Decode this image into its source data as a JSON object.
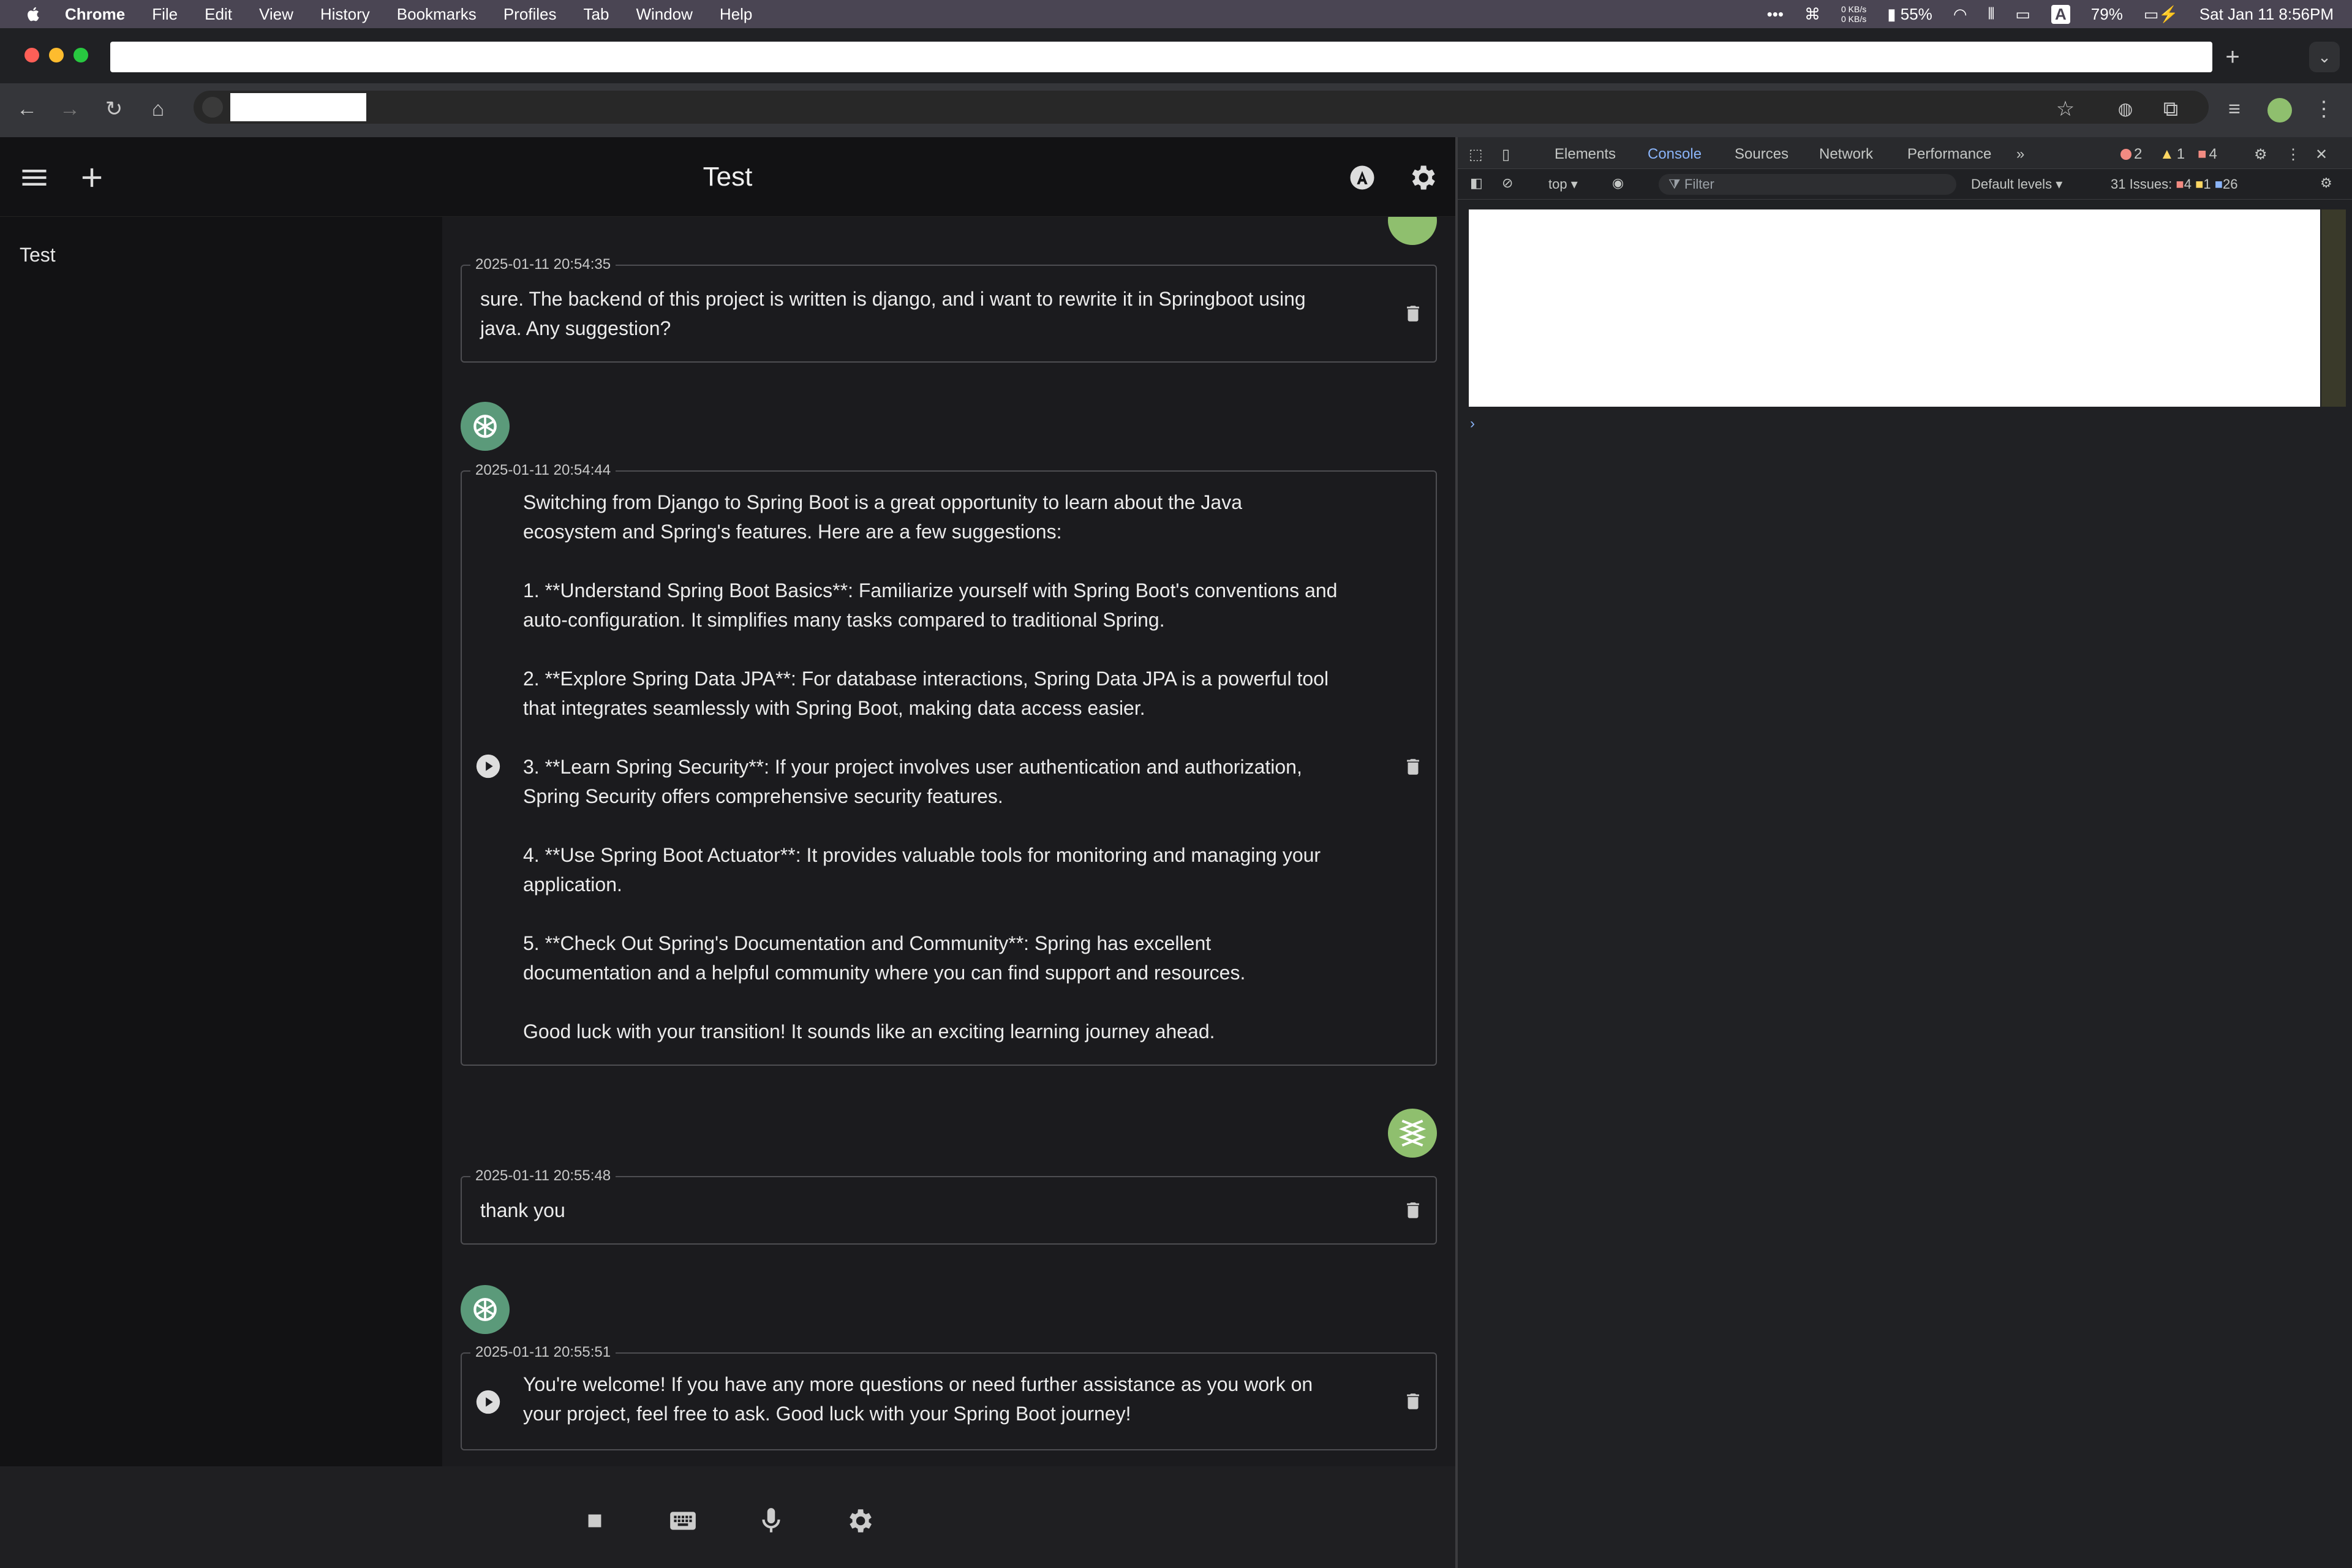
{
  "menubar": {
    "app_name": "Chrome",
    "menus": [
      "File",
      "Edit",
      "View",
      "History",
      "Bookmarks",
      "Profiles",
      "Tab",
      "Window",
      "Help"
    ],
    "net_up": "0 KB/s",
    "net_down": "0 KB/s",
    "cpu_percent": "55%",
    "input_source": "A",
    "battery_percent": "79%",
    "datetime": "Sat Jan 11  8:56PM"
  },
  "app": {
    "title": "Test",
    "sidebar": {
      "items": [
        {
          "label": "Test"
        }
      ]
    },
    "messages": [
      {
        "role": "user",
        "timestamp": "2025-01-11 20:54:35",
        "text": "sure. The backend of this project is written is django, and i want to rewrite it in Springboot using\njava. Any suggestion?"
      },
      {
        "role": "assistant",
        "timestamp": "2025-01-11 20:54:44",
        "text": "Switching from Django to Spring Boot is a great opportunity to learn about the Java\necosystem and Spring's features. Here are a few suggestions:\n\n1. **Understand Spring Boot Basics**: Familiarize yourself with Spring Boot's conventions and\nauto-configuration. It simplifies many tasks compared to traditional Spring.\n\n2. **Explore Spring Data JPA**: For database interactions, Spring Data JPA is a powerful tool\nthat integrates seamlessly with Spring Boot, making data access easier.\n\n3. **Learn Spring Security**: If your project involves user authentication and authorization,\nSpring Security offers comprehensive security features.\n\n4. **Use Spring Boot Actuator**: It provides valuable tools for monitoring and managing your\napplication.\n\n5. **Check Out Spring's Documentation and Community**: Spring has excellent\ndocumentation and a helpful community where you can find support and resources.\n\nGood luck with your transition! It sounds like an exciting learning journey ahead."
      },
      {
        "role": "user",
        "timestamp": "2025-01-11 20:55:48",
        "text": "thank you"
      },
      {
        "role": "assistant",
        "timestamp": "2025-01-11 20:55:51",
        "text": "You're welcome! If you have any more questions or need further assistance as you work on\nyour project, feel free to ask. Good luck with your Spring Boot journey!"
      }
    ]
  },
  "devtools": {
    "tabs": [
      "Elements",
      "Console",
      "Sources",
      "Network",
      "Performance"
    ],
    "active_tab": "Console",
    "errors": "2",
    "warnings": "1",
    "issues_badge": "4",
    "context": "top",
    "filter_placeholder": "Filter",
    "levels": "Default levels",
    "issues_label": "31 Issues:",
    "issues_errors": "4",
    "issues_warnings": "1",
    "issues_info": "26",
    "prompt": "›"
  }
}
